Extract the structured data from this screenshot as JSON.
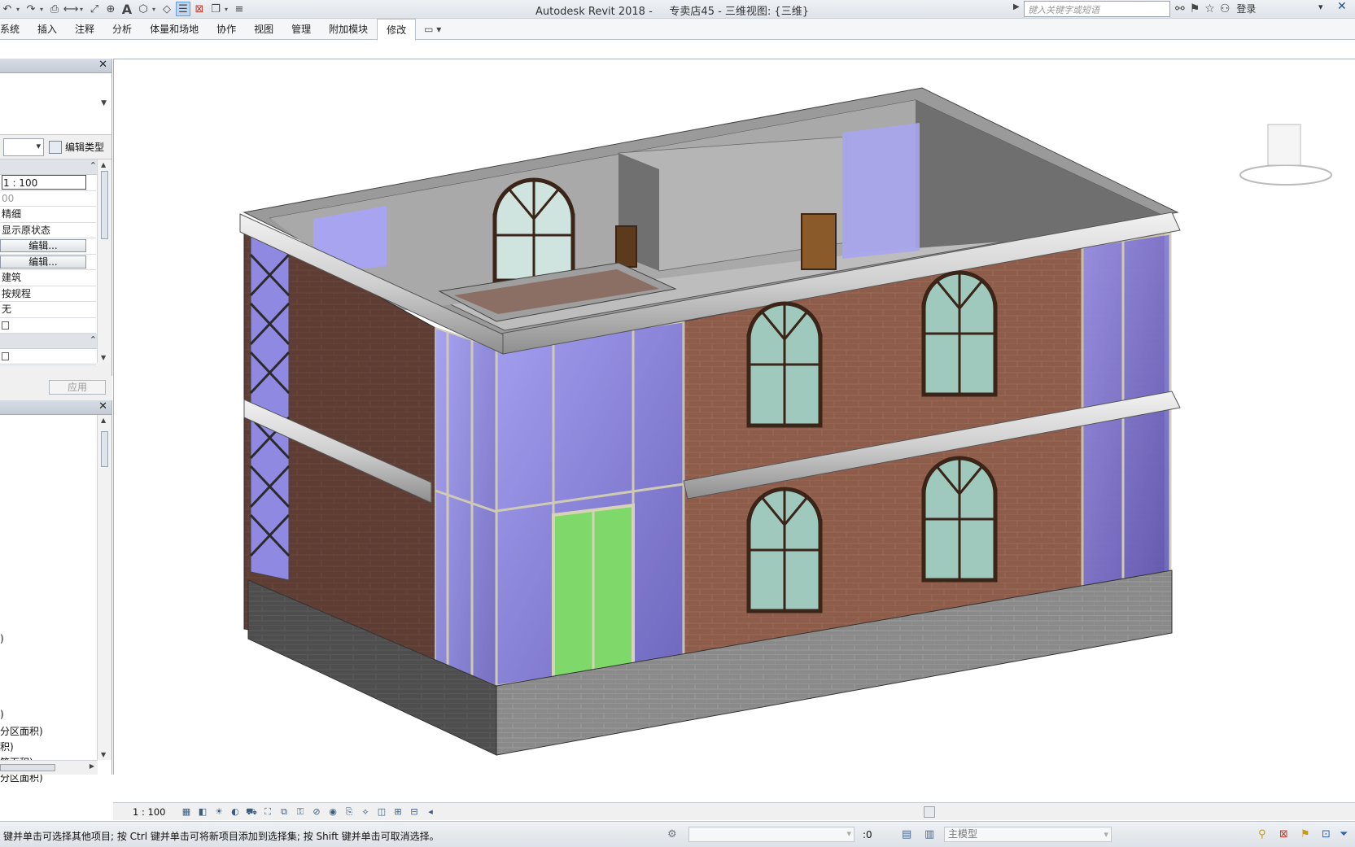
{
  "titlebar": {
    "app_title": "Autodesk Revit 2018 -     专卖店45 - 三维视图: {三维}",
    "search_placeholder": "键入关键字或短语",
    "login_label": "登录",
    "min_glyph": "▾",
    "close_glyph": "✕"
  },
  "ribbon": {
    "tabs": [
      {
        "label": "系统"
      },
      {
        "label": "插入"
      },
      {
        "label": "注释"
      },
      {
        "label": "分析"
      },
      {
        "label": "体量和场地"
      },
      {
        "label": "协作"
      },
      {
        "label": "视图"
      },
      {
        "label": "管理"
      },
      {
        "label": "附加模块"
      },
      {
        "label": "修改"
      }
    ],
    "active_tab": "修改",
    "extra_label": "▭ ▾"
  },
  "properties": {
    "edit_type_label": "编辑类型",
    "rows": {
      "scale": "1 : 100",
      "scale_value": "00",
      "detail_level": "精细",
      "parts_visibility": "显示原状态",
      "vg_overrides_button": "编辑...",
      "graphic_display_button": "编辑...",
      "discipline": "建筑",
      "show_hidden_lines": "按规程",
      "default_analysis": "无"
    },
    "apply_label": "应用"
  },
  "browser": {
    "items": [
      {
        "label": ")"
      },
      {
        "label": ")"
      },
      {
        "label": "分区面积)"
      },
      {
        "label": "积)"
      },
      {
        "label": "筑面积)"
      },
      {
        "label": "分区面积)"
      }
    ]
  },
  "view_bar": {
    "scale_label": "1 : 100"
  },
  "statusbar": {
    "text": "键并单击可选择其他项目; 按 Ctrl 键并单击可将新项目添加到选择集; 按 Shift 键并单击可取消选择。",
    "filter_count": ":0",
    "model_label": "主模型"
  },
  "colors": {
    "brick": "#8a5a48",
    "glass": "#7b74d8",
    "plinth": "#6b6b6b",
    "cornice": "#d9d9d9"
  }
}
